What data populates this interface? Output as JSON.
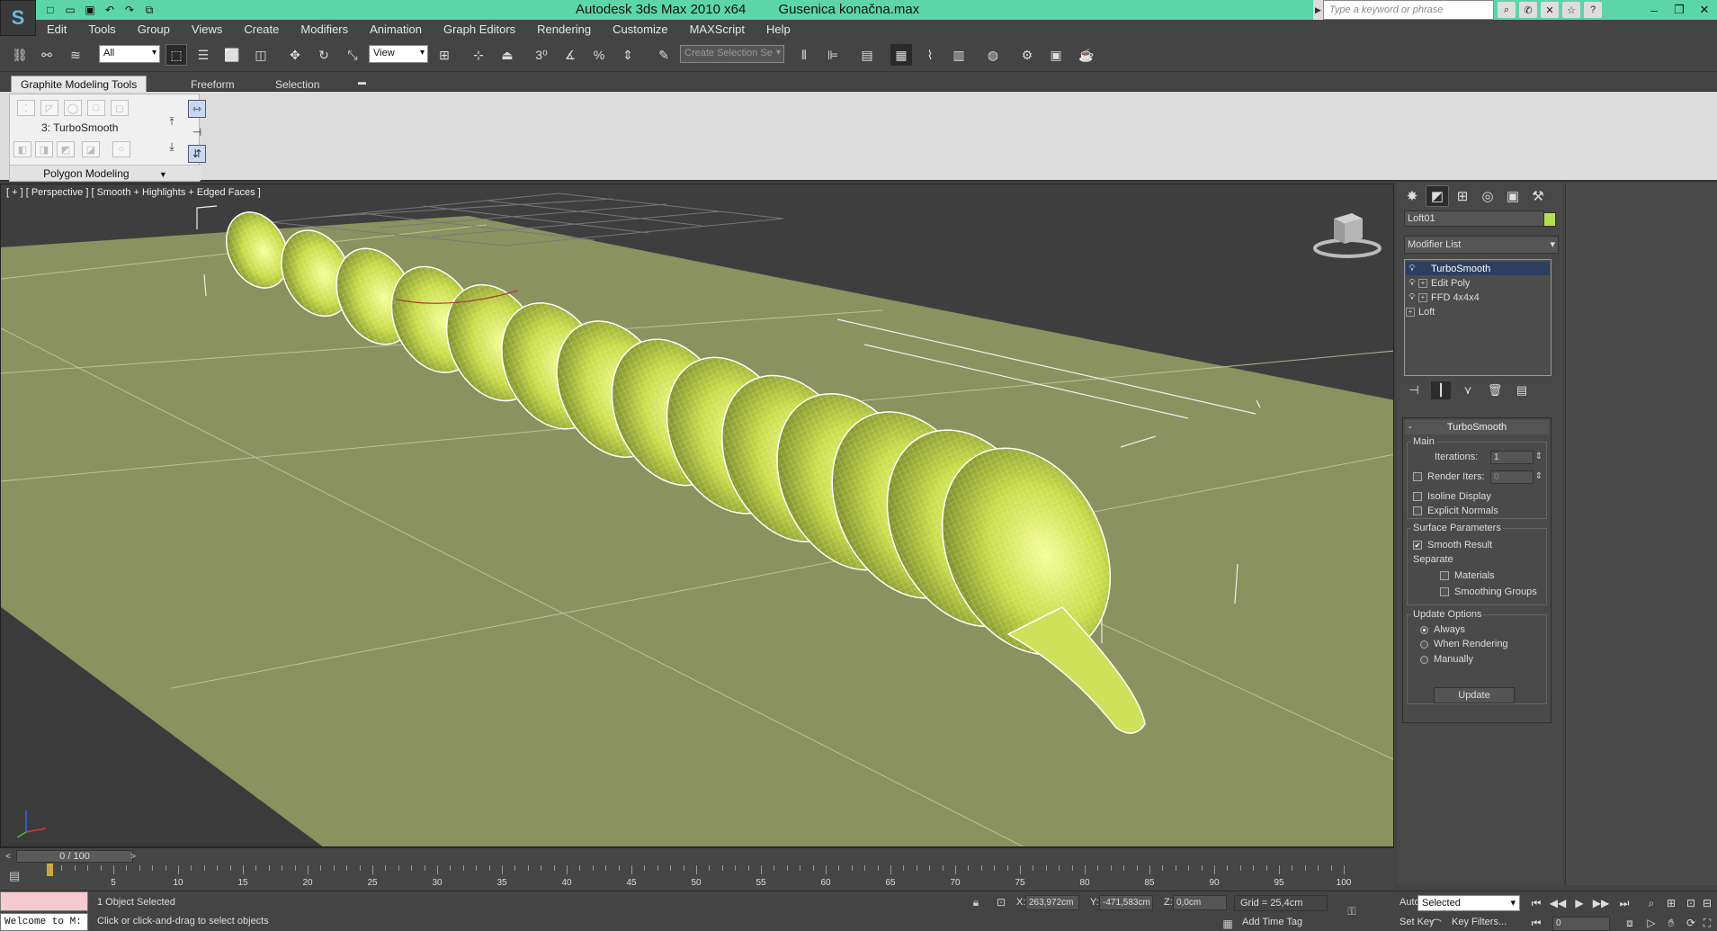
{
  "app": {
    "logo": "S",
    "name": "Autodesk 3ds Max  2010 x64",
    "file": "Gusenica konačna.max"
  },
  "quick_access": [
    "new-icon",
    "open-icon",
    "save-icon",
    "undo-icon",
    "redo-icon",
    "project-icon"
  ],
  "help": {
    "search_placeholder": "Type a keyword or phrase",
    "icons": [
      "binoculars-icon",
      "communication-center-icon",
      "favorites-icon",
      "star-icon",
      "help-icon"
    ]
  },
  "window_controls": [
    "minimize-icon",
    "restore-icon",
    "close-icon"
  ],
  "menu": [
    "Edit",
    "Tools",
    "Group",
    "Views",
    "Create",
    "Modifiers",
    "Animation",
    "Graph Editors",
    "Rendering",
    "Customize",
    "MAXScript",
    "Help"
  ],
  "toolbar": {
    "selection_filter": "All",
    "reference_coord": "View",
    "named_selection": "Create Selection Se"
  },
  "ribbon": {
    "tabs": [
      "Graphite Modeling Tools",
      "Freeform",
      "Selection"
    ],
    "active_tab": "Graphite Modeling Tools",
    "stack_label": "3: TurboSmooth",
    "panel_title": "Polygon Modeling"
  },
  "viewport": {
    "label": "[ + ] [ Perspective ] [ Smooth + Highlights + Edged Faces ]",
    "object_color": "#c8dc4a",
    "ground_color": "#8a9260",
    "background_color": "#3d3d3d",
    "segments": 14
  },
  "command_panel": {
    "object_name": "Loft01",
    "object_color": "#b4e050",
    "modifier_list": "Modifier List",
    "stack": [
      {
        "label": "TurboSmooth",
        "selected": true,
        "bulb": true,
        "expand": false
      },
      {
        "label": "Edit Poly",
        "selected": false,
        "bulb": true,
        "expand": true
      },
      {
        "label": "FFD 4x4x4",
        "selected": false,
        "bulb": true,
        "expand": true
      },
      {
        "label": "Loft",
        "selected": false,
        "bulb": false,
        "expand": true
      }
    ],
    "rollout": {
      "title": "TurboSmooth",
      "main_title": "Main",
      "iterations_label": "Iterations:",
      "iterations_value": "1",
      "render_iters_label": "Render Iters:",
      "render_iters_value": "0",
      "render_iters_checked": false,
      "isoline_display": "Isoline Display",
      "isoline_checked": false,
      "explicit_normals": "Explicit Normals",
      "explicit_checked": false,
      "surface_title": "Surface Parameters",
      "smooth_result": "Smooth Result",
      "smooth_checked": true,
      "separate_label": "Separate",
      "materials": "Materials",
      "materials_checked": false,
      "smoothing_groups": "Smoothing Groups",
      "smoothing_checked": false,
      "update_title": "Update Options",
      "update_options": [
        "Always",
        "When Rendering",
        "Manually"
      ],
      "update_selected": "Always",
      "update_button": "Update"
    }
  },
  "timeline": {
    "position": "0 / 100",
    "ticks": [
      0,
      5,
      10,
      15,
      20,
      25,
      30,
      35,
      40,
      45,
      50,
      55,
      60,
      65,
      70,
      75,
      80,
      85,
      90,
      95,
      100
    ],
    "labels": [
      "5",
      "10",
      "15",
      "20",
      "25",
      "30",
      "35",
      "40",
      "45",
      "50",
      "55",
      "60",
      "65",
      "70",
      "75",
      "80",
      "85",
      "90",
      "95",
      "100"
    ]
  },
  "status": {
    "maxscript_welcome": "Welcome to M:",
    "selected": "1 Object Selected",
    "prompt": "Click or click-and-drag to select objects",
    "x_label": "X:",
    "x_value": "263,972cm",
    "y_label": "Y:",
    "y_value": "-471,583cm",
    "z_label": "Z:",
    "z_value": "0,0cm",
    "grid": "Grid = 25,4cm",
    "add_time_tag": "Add Time Tag",
    "auto_key": "Auto Key",
    "set_key": "Set Key",
    "key_mode": "Selected",
    "key_filters": "Key Filters...",
    "frame": "0"
  }
}
